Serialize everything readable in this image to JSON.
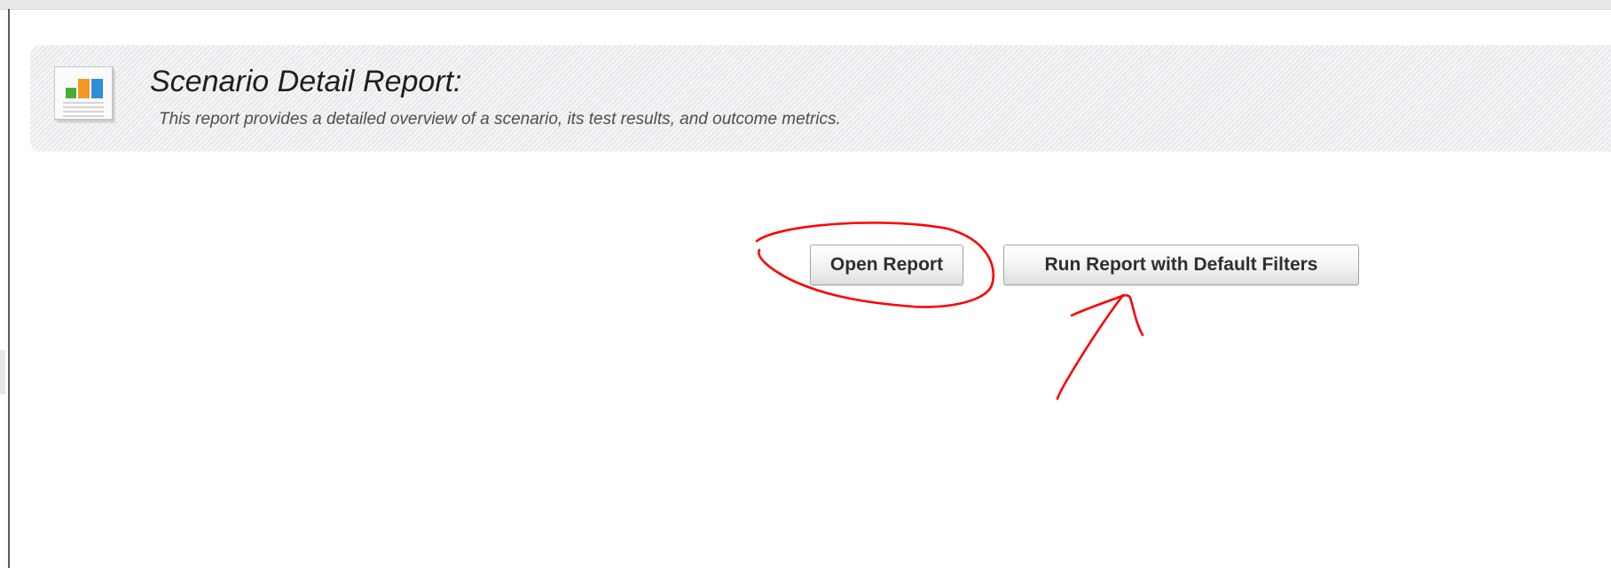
{
  "banner": {
    "title": "Scenario Detail Report:",
    "description": "This report provides a detailed overview of a scenario, its test results, and outcome metrics.",
    "icon": "report-chart-icon"
  },
  "actions": {
    "open_report_label": "Open Report",
    "run_default_label": "Run Report with Default Filters"
  },
  "annotations": {
    "color": "#ff0000",
    "circle_target": "Open Report",
    "arrow_target": "Run Report with Default Filters"
  },
  "colors": {
    "icon_green": "#4cab3c",
    "icon_orange": "#f29a21",
    "icon_blue": "#2f8ed8"
  }
}
